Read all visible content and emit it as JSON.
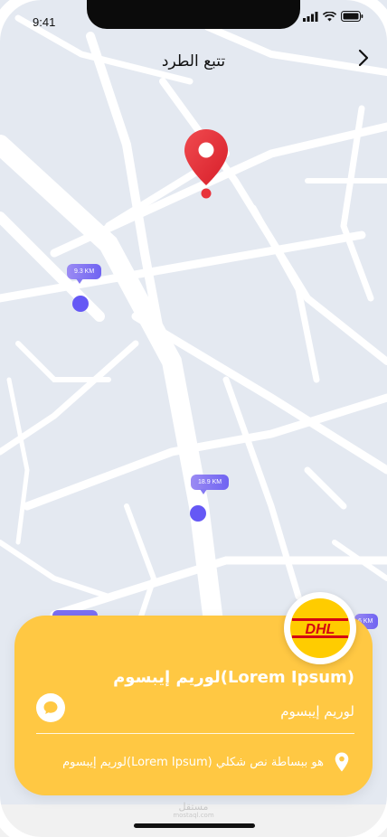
{
  "status_bar": {
    "time": "9:41"
  },
  "header": {
    "title": "تتبع الطرد",
    "back_icon": "chevron-right-icon"
  },
  "map": {
    "destination_pin_icon": "map-pin-icon",
    "markers": [
      {
        "distance": "9.3 KM"
      },
      {
        "distance": "18.9 KM"
      },
      {
        "distance": "6 KM"
      }
    ]
  },
  "courier_card": {
    "logo_text": "DHL",
    "title": "(Lorem Ipsum)لوريم إيبسوم",
    "subtitle": "لوريم إيبسوم",
    "chat_icon": "chat-bubble-icon",
    "location_icon": "location-pin-icon",
    "address": "هو ببساطة نص شكلي (Lorem Ipsum)لوريم إيبسوم"
  },
  "watermark": {
    "text": "مستقل",
    "sub": "mostaql.com"
  },
  "colors": {
    "accent": "#ffc843",
    "marker": "#6558f5",
    "pin": "#e8323a"
  }
}
